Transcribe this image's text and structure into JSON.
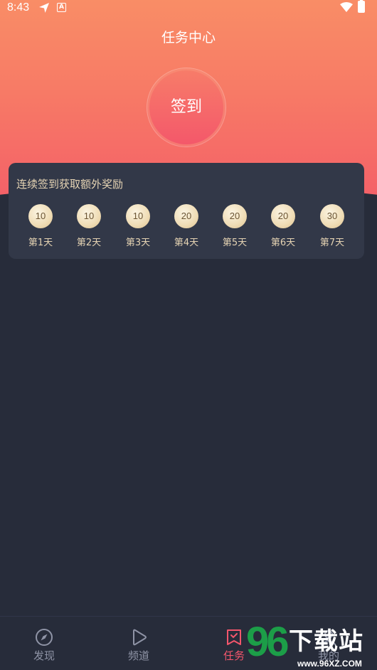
{
  "status_bar": {
    "time": "8:43",
    "notification_glyph": "A"
  },
  "header": {
    "title": "任务中心"
  },
  "sign_in": {
    "label": "签到"
  },
  "reward_card": {
    "title": "连续签到获取额外奖励",
    "days": [
      {
        "points": "10",
        "label": "第1天"
      },
      {
        "points": "10",
        "label": "第2天"
      },
      {
        "points": "10",
        "label": "第3天"
      },
      {
        "points": "20",
        "label": "第4天"
      },
      {
        "points": "20",
        "label": "第5天"
      },
      {
        "points": "20",
        "label": "第6天"
      },
      {
        "points": "30",
        "label": "第7天"
      }
    ]
  },
  "bottom_nav": {
    "items": [
      {
        "label": "发现",
        "icon": "compass-icon",
        "active": false
      },
      {
        "label": "频道",
        "icon": "play-icon",
        "active": false
      },
      {
        "label": "任务",
        "icon": "task-check-icon",
        "active": true
      },
      {
        "label": "我的",
        "icon": "user-icon",
        "active": false
      }
    ]
  },
  "watermark": {
    "number": "96",
    "text": "下载站",
    "url": "www.96XZ.COM"
  },
  "colors": {
    "gradient_top": "#f98d66",
    "gradient_bottom": "#f45f68",
    "background": "#272c3a",
    "card": "#323848",
    "gold_text": "#e5d3b3",
    "active_nav": "#f4566c",
    "inactive_nav": "#8f94a6"
  }
}
